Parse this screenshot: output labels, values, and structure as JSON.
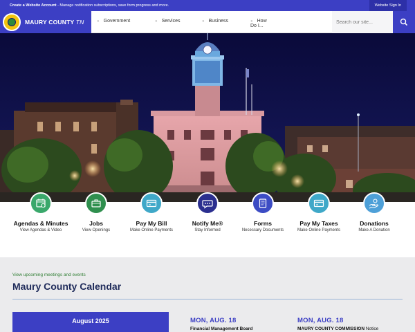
{
  "topbar": {
    "create_account_link": "Create a Website Account",
    "create_account_desc": " - Manage notification subscriptions, save form progress and more.",
    "signin_label": "Website Sign In"
  },
  "brand": {
    "name": "MAURY COUNTY",
    "state": "TN",
    "colors": {
      "primary": "#3c3fc4",
      "seal_gold": "#f2c40f"
    }
  },
  "nav": {
    "items": [
      {
        "label": "Government"
      },
      {
        "label": "Services"
      },
      {
        "label": "Business"
      },
      {
        "label": "How Do I..."
      }
    ]
  },
  "search": {
    "placeholder": "Search our site..."
  },
  "quick_links": [
    {
      "title": "Agendas & Minutes",
      "subtitle": "View Agendas & Video",
      "icon": "calendar-icon",
      "color": "#3aa86b"
    },
    {
      "title": "Jobs",
      "subtitle": "View Openings",
      "icon": "briefcase-icon",
      "color": "#2f8f4e"
    },
    {
      "title": "Pay My Bill",
      "subtitle": "Make Online Payments",
      "icon": "credit-card-icon",
      "color": "#3fa8c8"
    },
    {
      "title": "Notify Me®",
      "subtitle": "Stay Informed",
      "icon": "chat-bubble-icon",
      "color": "#2b2f8f"
    },
    {
      "title": "Forms",
      "subtitle": "Necessary Documents",
      "icon": "document-icon",
      "color": "#3c4cc4"
    },
    {
      "title": "Pay My Taxes",
      "subtitle": "Make Online Payments",
      "icon": "credit-card-icon",
      "color": "#3fa8c8"
    },
    {
      "title": "Donations",
      "subtitle": "Make A Donation",
      "icon": "donation-hand-icon",
      "color": "#4ea0d8"
    }
  ],
  "calendar": {
    "kicker": "View upcoming meetings and events",
    "title": "Maury County Calendar",
    "month_label": "August 2025",
    "events": [
      {
        "date": "MON, AUG. 18",
        "name_bold": "Financial Management Board",
        "name_rest": ""
      },
      {
        "date": "MON, AUG. 18",
        "name_bold": "MAURY COUNTY COMMISSION",
        "name_rest": " Notice"
      }
    ]
  }
}
